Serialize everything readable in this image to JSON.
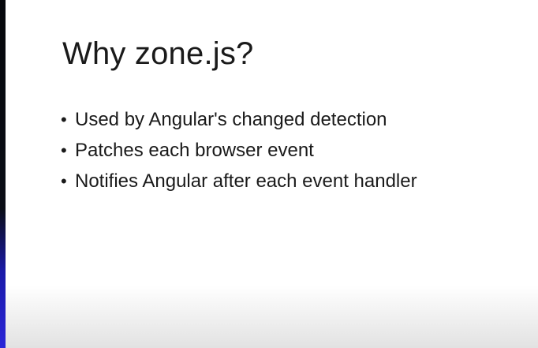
{
  "slide": {
    "title": "Why zone.js?",
    "bullet_symbol": "•",
    "bullets": [
      "Used by Angular's changed detection",
      "Patches each browser event",
      "Notifies Angular after each event handler"
    ]
  },
  "colors": {
    "text": "#1a1a1a",
    "background": "#ffffff",
    "left_edge_dark": "#0a0d16",
    "left_edge_blue": "#2a25d8"
  }
}
